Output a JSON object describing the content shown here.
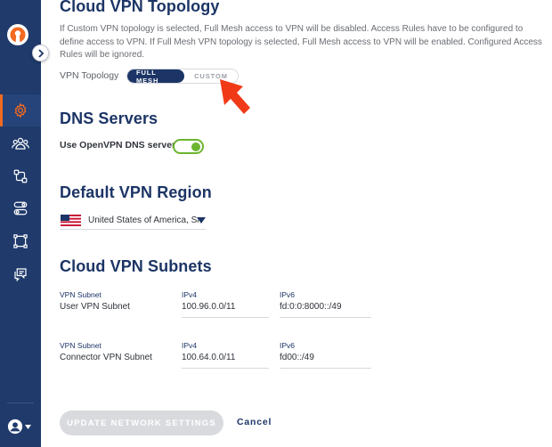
{
  "topology": {
    "title": "Cloud VPN Topology",
    "description": "If Custom VPN topology is selected, Full Mesh access to VPN will be disabled. Access Rules have to be configured to define access to VPN. If Full Mesh VPN topology is selected, Full Mesh access to VPN will be enabled. Configured Access Rules will be ignored.",
    "label": "VPN Topology",
    "options": [
      "FULL MESH",
      "CUSTOM"
    ],
    "selected": "FULL MESH"
  },
  "dns": {
    "title": "DNS Servers",
    "toggle_label": "Use OpenVPN DNS server",
    "enabled": true
  },
  "region": {
    "title": "Default VPN Region",
    "value": "United States of America, San Jose"
  },
  "subnets": {
    "title": "Cloud VPN Subnets",
    "rows": [
      {
        "type_label": "VPN Subnet",
        "name": "User VPN Subnet",
        "ipv4_label": "IPv4",
        "ipv4": "100.96.0.0/11",
        "ipv6_label": "IPv6",
        "ipv6": "fd:0:0:8000::/49"
      },
      {
        "type_label": "VPN Subnet",
        "name": "Connector VPN Subnet",
        "ipv4_label": "IPv4",
        "ipv4": "100.64.0.0/11",
        "ipv6_label": "IPv6",
        "ipv6": "fd00::/49"
      }
    ]
  },
  "actions": {
    "update": "UPDATE NETWORK SETTINGS",
    "cancel": "Cancel"
  },
  "icons": {
    "logo": "openvpn-logo",
    "nav": [
      "gear-icon",
      "users-icon",
      "network-icon",
      "settings-toggle-icon",
      "hub-icon",
      "chat-icon"
    ],
    "account": "account-icon"
  },
  "colors": {
    "sidebar": "#1f3a6b",
    "brand_dark": "#1c3566",
    "accent_orange": "#f26a21",
    "toggle_green": "#6cb52e",
    "arrow_red": "#f03a17"
  }
}
